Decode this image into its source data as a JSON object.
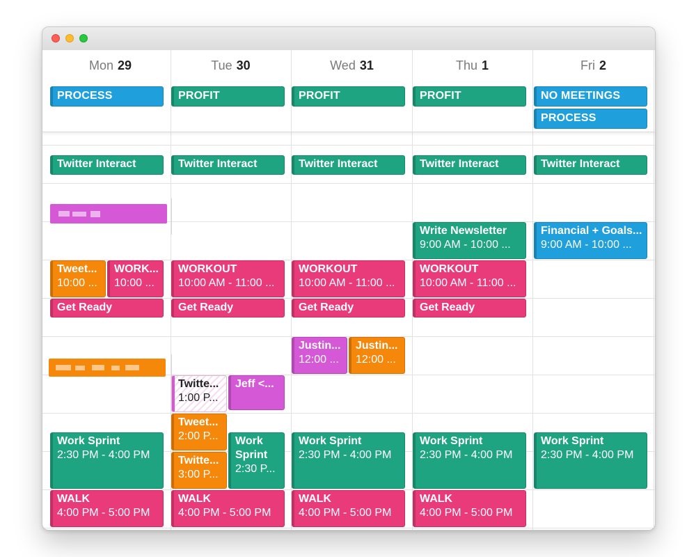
{
  "days": [
    {
      "name": "Mon",
      "num": "29"
    },
    {
      "name": "Tue",
      "num": "30"
    },
    {
      "name": "Wed",
      "num": "31"
    },
    {
      "name": "Thu",
      "num": "1"
    },
    {
      "name": "Fri",
      "num": "2"
    }
  ],
  "allday": {
    "mon_1": "PROCESS",
    "tue_1": "PROFIT",
    "wed_1": "PROFIT",
    "thu_1": "PROFIT",
    "fri_1": "NO MEETINGS",
    "fri_2": "PROCESS"
  },
  "events": {
    "twitter_mon": "Twitter Interact",
    "twitter_tue": "Twitter Interact",
    "twitter_wed": "Twitter Interact",
    "twitter_thu": "Twitter Interact",
    "twitter_fri": "Twitter Interact",
    "newsletter_thu": {
      "title": "Write Newsletter",
      "time": "9:00 AM - 10:00 ..."
    },
    "financial_fri": {
      "title": "Financial + Goals...",
      "time": "9:00 AM - 10:00 ..."
    },
    "tweet_mon": {
      "title": "Tweet...",
      "time": "10:00 ..."
    },
    "workout_mon": {
      "title": "WORK...",
      "time": "10:00 ..."
    },
    "workout_tue": {
      "title": "WORKOUT",
      "time": "10:00 AM - 11:00 ..."
    },
    "workout_wed": {
      "title": "WORKOUT",
      "time": "10:00 AM - 11:00 ..."
    },
    "workout_thu": {
      "title": "WORKOUT",
      "time": "10:00 AM - 11:00 ..."
    },
    "getready_mon": "Get Ready",
    "getready_tue": "Get Ready",
    "getready_wed": "Get Ready",
    "getready_thu": "Get Ready",
    "justin_wed_1": {
      "title": "Justin...",
      "time": "12:00 ..."
    },
    "justin_wed_2": {
      "title": "Justin...",
      "time": "12:00 ..."
    },
    "twitte_tue": {
      "title": "Twitte...",
      "time": "1:00 P..."
    },
    "jeff_tue": {
      "title": "Jeff <..."
    },
    "tweet_tue_2pm": {
      "title": "Tweet...",
      "time": "2:00 P..."
    },
    "twitte_tue_3pm": {
      "title": "Twitte...",
      "time": "3:00 P..."
    },
    "sprint_tue": {
      "title": "Work Sprint",
      "time": "2:30 P..."
    },
    "sprint_mon": {
      "title": "Work Sprint",
      "time": "2:30 PM - 4:00 PM"
    },
    "sprint_wed": {
      "title": "Work Sprint",
      "time": "2:30 PM - 4:00 PM"
    },
    "sprint_thu": {
      "title": "Work Sprint",
      "time": "2:30 PM - 4:00 PM"
    },
    "sprint_fri": {
      "title": "Work Sprint",
      "time": "2:30 PM - 4:00 PM"
    },
    "walk_mon": {
      "title": "WALK",
      "time": "4:00 PM - 5:00 PM"
    },
    "walk_tue": {
      "title": "WALK",
      "time": "4:00 PM - 5:00 PM"
    },
    "walk_wed": {
      "title": "WALK",
      "time": "4:00 PM - 5:00 PM"
    },
    "walk_thu": {
      "title": "WALK",
      "time": "4:00 PM - 5:00 PM"
    }
  },
  "colors": {
    "green": "#1fa482",
    "blue": "#1fa0dc",
    "pink": "#e93b79",
    "orange": "#f5870a",
    "purple": "#d559d6"
  }
}
